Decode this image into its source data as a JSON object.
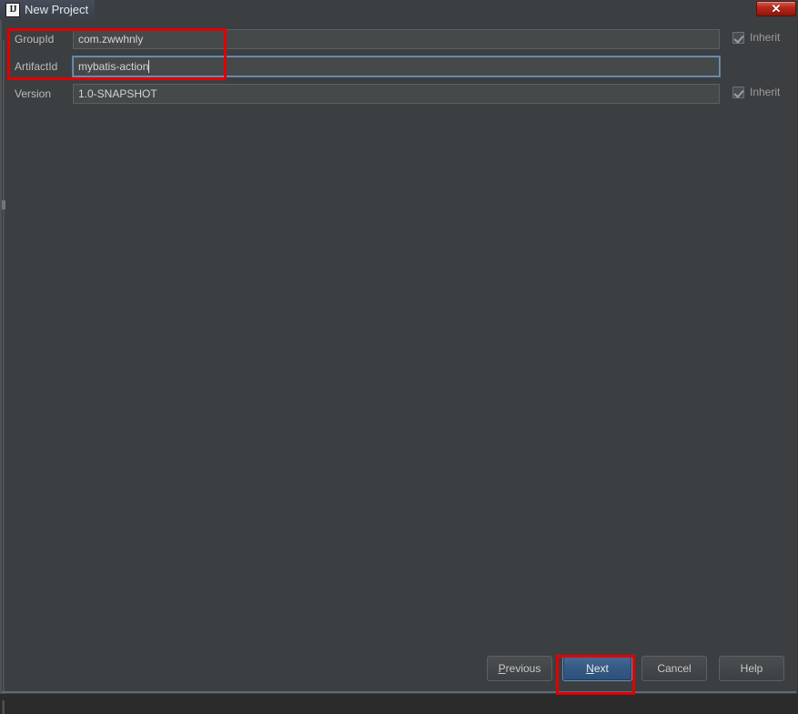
{
  "window": {
    "title": "New Project",
    "app_icon": "intellij-idea-icon",
    "close_icon": "close-x-icon",
    "close_label": "✕"
  },
  "form": {
    "rows": [
      {
        "label": "GroupId",
        "value": "com.zwwhnly",
        "placeholder": "",
        "field_name": "groupid-input",
        "focused": false,
        "inherit": {
          "label": "Inherit",
          "checked": true,
          "visible": true
        }
      },
      {
        "label": "ArtifactId",
        "value": "mybatis-action",
        "placeholder": "",
        "field_name": "artifactid-input",
        "focused": true,
        "inherit": {
          "label": "",
          "checked": false,
          "visible": false
        }
      },
      {
        "label": "Version",
        "value": "1.0-SNAPSHOT",
        "placeholder": "",
        "field_name": "version-input",
        "focused": false,
        "inherit": {
          "label": "Inherit",
          "checked": true,
          "visible": true
        }
      }
    ]
  },
  "buttons": {
    "previous": {
      "label": "Previous",
      "mnemonic": "P",
      "default": false
    },
    "next": {
      "label": "Next",
      "mnemonic": "N",
      "default": true
    },
    "cancel": {
      "label": "Cancel",
      "mnemonic": "",
      "default": false
    },
    "help": {
      "label": "Help",
      "mnemonic": "",
      "default": false
    }
  },
  "annotations": [
    {
      "name": "highlight-groupid-artifactid",
      "color": "#e00000"
    },
    {
      "name": "highlight-next-button",
      "color": "#e00000"
    }
  ],
  "colors": {
    "dialog_bg": "#3c3f41",
    "field_bg": "#45494a",
    "field_border": "#5a5f61",
    "focus_border": "#7093b5",
    "text": "#d4d4d4",
    "label": "#bbbbbb",
    "default_button": "#365b86",
    "annotation": "#e00000",
    "close_button": "#b9291c"
  }
}
